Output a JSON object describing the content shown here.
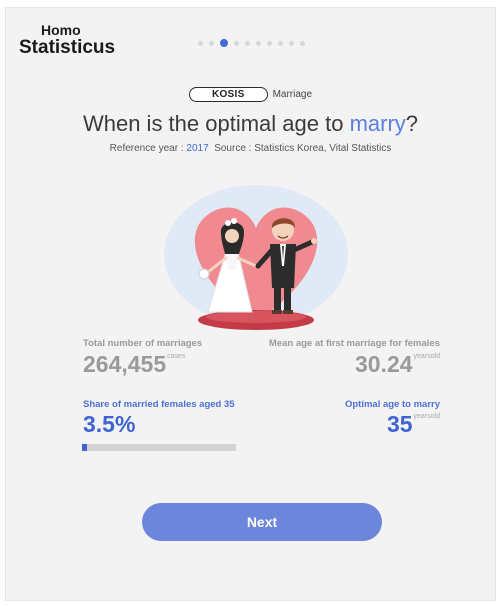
{
  "logo": {
    "line1": "Homo",
    "line2": "Statisticus"
  },
  "pagination": {
    "total": 10,
    "active_index": 2
  },
  "tag": {
    "pill": "KOSIS",
    "label": "Marriage"
  },
  "question": {
    "prefix": "When is the optimal age to ",
    "highlight": "marry",
    "suffix": "?"
  },
  "reference": {
    "year_label": "Reference year : ",
    "year": "2017",
    "source": "Source : Statistics Korea, Vital Statistics"
  },
  "stats": {
    "total_marriages": {
      "label": "Total number of marriages",
      "value": "264,455",
      "unit": "cases"
    },
    "mean_age_females": {
      "label": "Mean age at first marriage for females",
      "value": "30.24",
      "unit": "yearsold"
    },
    "share_married_35": {
      "label": "Share of married females aged 35",
      "value": "3.5%",
      "progress_percent": 3.5
    },
    "optimal_age": {
      "label": "Optimal age to marry",
      "value": "35",
      "unit": "yearsold"
    }
  },
  "next_button": {
    "label": "Next"
  },
  "colors": {
    "accent": "#3f63d3",
    "button": "#6c86dc",
    "heart": "#f08a90",
    "background": "#f3f3f3"
  }
}
